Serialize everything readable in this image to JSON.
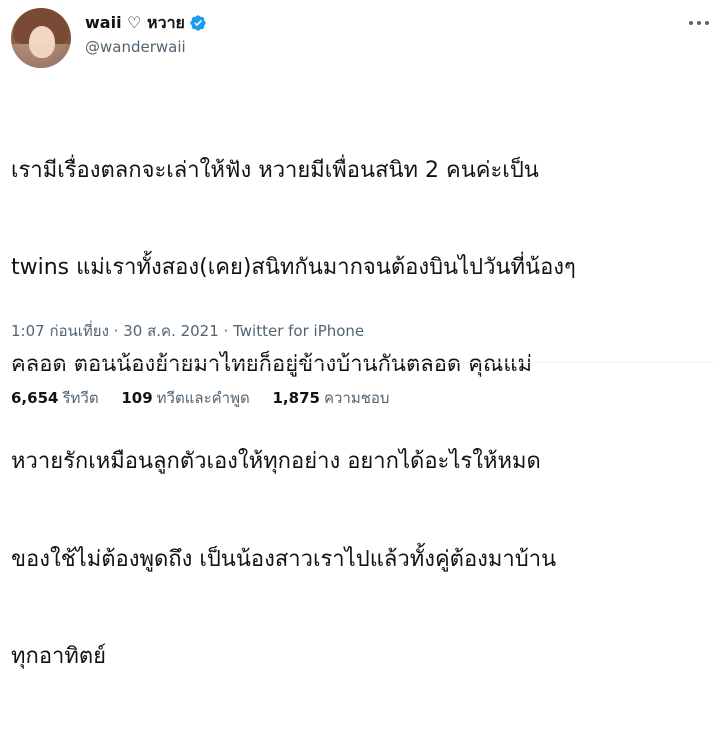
{
  "author": {
    "display_name": "waii ♡ หวาย",
    "handle": "@wanderwaii",
    "verified": true
  },
  "tweet": {
    "lines": [
      "เรามีเรื่องตลกจะเล่าให้ฟัง หวายมีเพื่อนสนิท 2 คนค่ะเป็น",
      "twins แม่เราทั้งสอง(เคย)สนิทกันมากจนต้องบินไปวันที่น้องๆ",
      "คลอด ตอนน้องย้ายมาไทยก็อยู่ข้างบ้านกันตลอด คุณแม่",
      "หวายรักเหมือนลูกตัวเองให้ทุกอย่าง อยากได้อะไรให้หมด",
      "ของใช้ไม่ต้องพูดถึง เป็นน้องสาวเราไปแล้วทั้งคู่ต้องมาบ้าน",
      "ทุกอาทิตย์"
    ]
  },
  "meta": {
    "time": "1:07 ก่อนเที่ยง",
    "separator": " · ",
    "date": "30 ส.ค. 2021",
    "source": "Twitter for iPhone"
  },
  "stats": {
    "retweets": {
      "count": "6,654",
      "label": "รีทวีต"
    },
    "quotes": {
      "count": "109",
      "label": "ทวีตและคำพูด"
    },
    "likes": {
      "count": "1,875",
      "label": "ความชอบ"
    }
  },
  "colors": {
    "verified_badge": "#1d9bf0",
    "secondary_text": "#536471",
    "primary_text": "#0f1419"
  },
  "icons": {
    "verified": "verified-badge-icon",
    "more": "more-options-icon"
  }
}
